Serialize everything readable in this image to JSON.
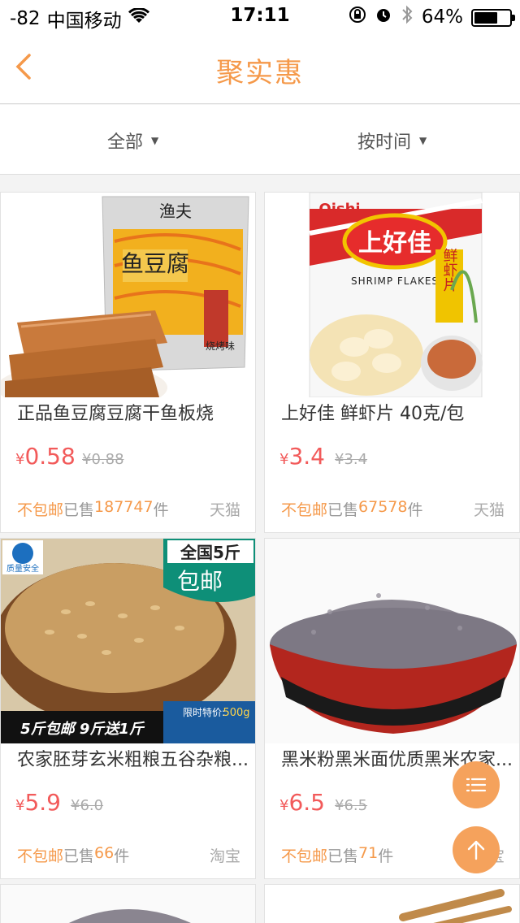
{
  "status": {
    "signal": "-82",
    "carrier": "中国移动",
    "time": "17:11",
    "battery": "64%"
  },
  "nav": {
    "title": "聚实惠",
    "accent": "#f5994a"
  },
  "filters": {
    "category": "全部",
    "sort": "按时间"
  },
  "products": [
    {
      "title": "正品鱼豆腐豆腐干鱼板烧",
      "currency": "¥",
      "price": "0.58",
      "original_price": "¥0.88",
      "shipping": "不包邮",
      "sold_prefix": "已售",
      "sold_count": "187747",
      "sold_suffix": "件",
      "store": "天猫",
      "image_text": [
        "渔夫",
        "鱼豆腐",
        "烧烤味"
      ]
    },
    {
      "title": "上好佳 鲜虾片 40克/包",
      "currency": "¥",
      "price": "3.4",
      "original_price": "¥3.4",
      "shipping": "不包邮",
      "sold_prefix": "已售",
      "sold_count": "67578",
      "sold_suffix": "件",
      "store": "天猫",
      "image_text": [
        "Oishi",
        "上好佳",
        "SHRIMP FLAKES",
        "鲜虾片"
      ]
    },
    {
      "title": "农家胚芽玄米粗粮五谷杂粮...",
      "currency": "¥",
      "price": "5.9",
      "original_price": "¥6.0",
      "shipping": "不包邮",
      "sold_prefix": "已售",
      "sold_count": "66",
      "sold_suffix": "件",
      "store": "淘宝",
      "image_text": [
        "全国5斤",
        "包邮",
        "质量安全",
        "5斤包邮 9斤送1斤",
        "限时特价:",
        "500g"
      ]
    },
    {
      "title": "黑米粉黑米面优质黑米农家...",
      "currency": "¥",
      "price": "6.5",
      "original_price": "¥6.5",
      "shipping": "不包邮",
      "sold_prefix": "已售",
      "sold_count": "71",
      "sold_suffix": "件",
      "store": "淘宝",
      "image_text": []
    }
  ],
  "fabs": {
    "menu": "list-icon",
    "top": "arrow-up-icon"
  }
}
